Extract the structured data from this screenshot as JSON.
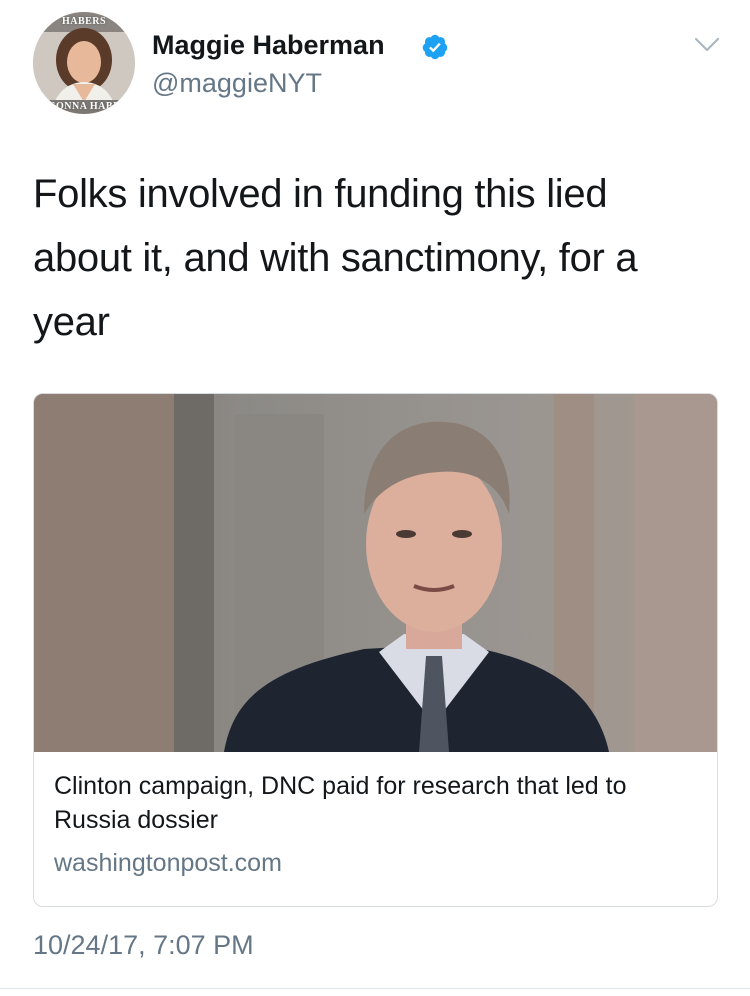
{
  "author": {
    "display_name": "Maggie Haberman",
    "handle": "@maggieNYT",
    "verified": true,
    "avatar_top_text": "HABERS",
    "avatar_bottom_text": "GONNA HABE"
  },
  "tweet": {
    "text": "Folks involved in funding this lied about it, and with sanctimony, for a year",
    "timestamp": "10/24/17, 7:07 PM"
  },
  "link_card": {
    "title": "Clinton campaign, DNC paid for research that led to Russia dossier",
    "domain": "washingtonpost.com"
  },
  "icons": {
    "verified": "verified-badge-icon",
    "menu": "chevron-down-icon"
  },
  "colors": {
    "verified_blue": "#1da1f2",
    "secondary_text": "#657786",
    "primary_text": "#14171a"
  }
}
